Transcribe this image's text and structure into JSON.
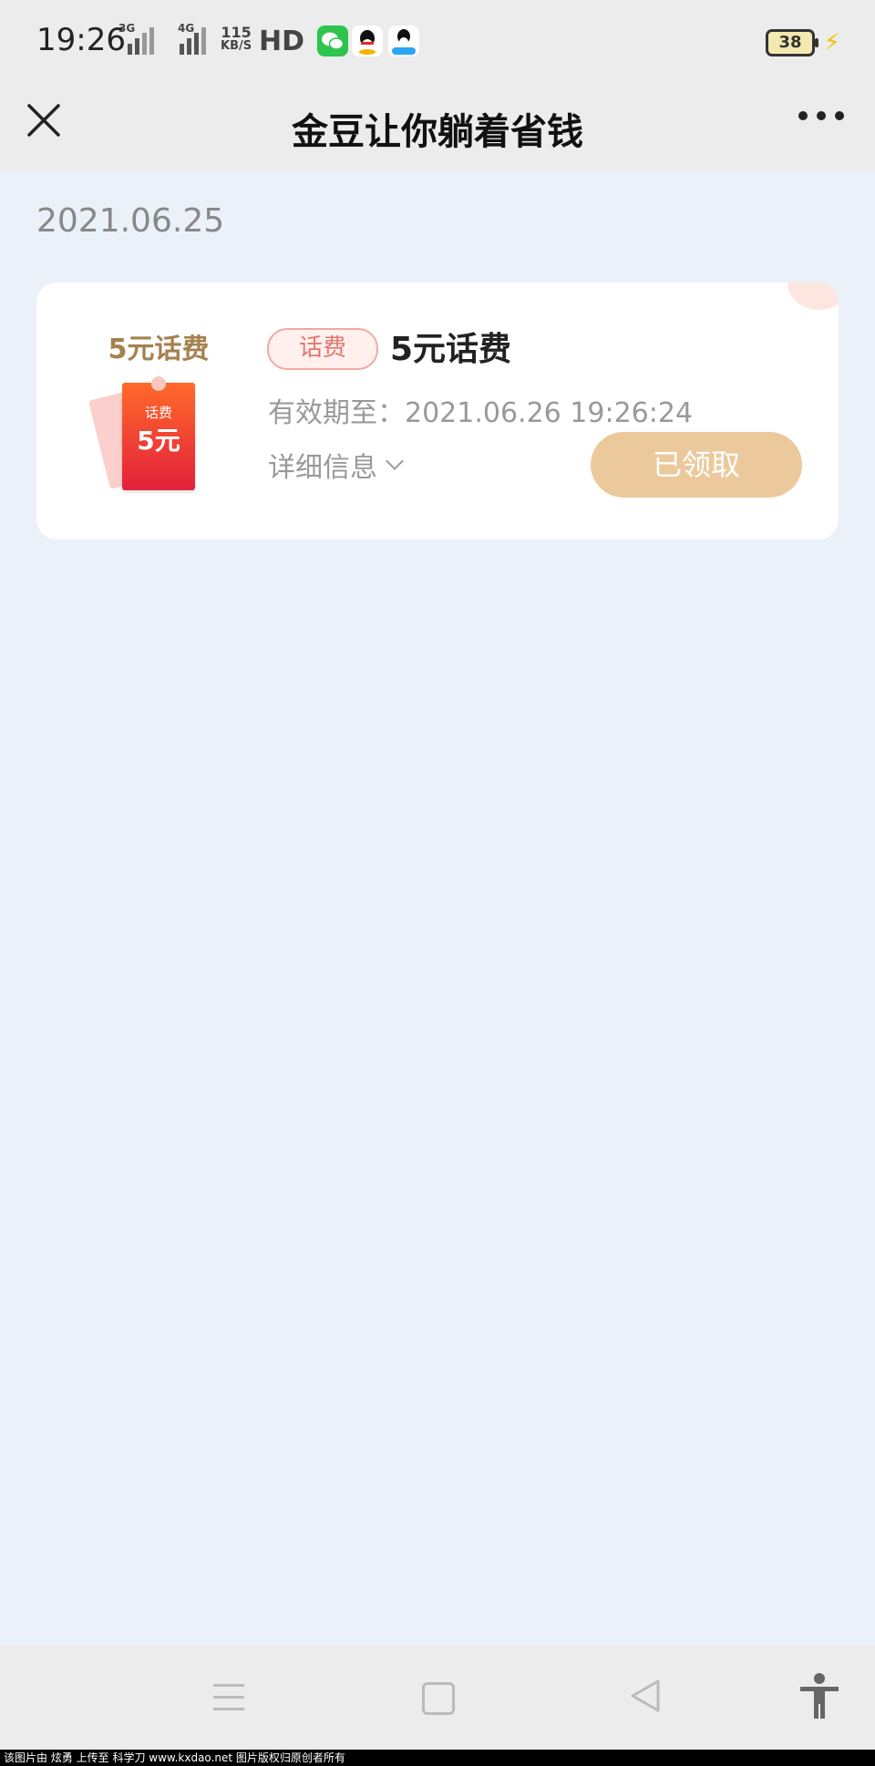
{
  "status_bar": {
    "time": "19:26",
    "net1": "3G",
    "net2": "4G",
    "speed_value": "115",
    "speed_unit": "KB/S",
    "hd": "HD",
    "battery": "38"
  },
  "header": {
    "title": "金豆让你躺着省钱",
    "close_icon": "close-icon",
    "more_icon": "more-icon"
  },
  "date": "2021.06.25",
  "card": {
    "thumb_title": "5元话费",
    "thumb_small": "话费",
    "thumb_big": "5元",
    "tag": "话费",
    "title": "5元话费",
    "expiry": "有效期至：2021.06.26 19:26:24",
    "detail": "详细信息",
    "button": "已领取",
    "colors": {
      "button": "#ecc99d",
      "tag_text": "#e4766d",
      "tag_border": "#f2a9a3"
    }
  },
  "nav": {
    "menu": "menu-icon",
    "home": "home-icon",
    "back": "back-icon",
    "accessibility": "accessibility-icon"
  },
  "footer": "该图片由 炫勇 上传至 科学刀 www.kxdao.net 图片版权归原创者所有"
}
